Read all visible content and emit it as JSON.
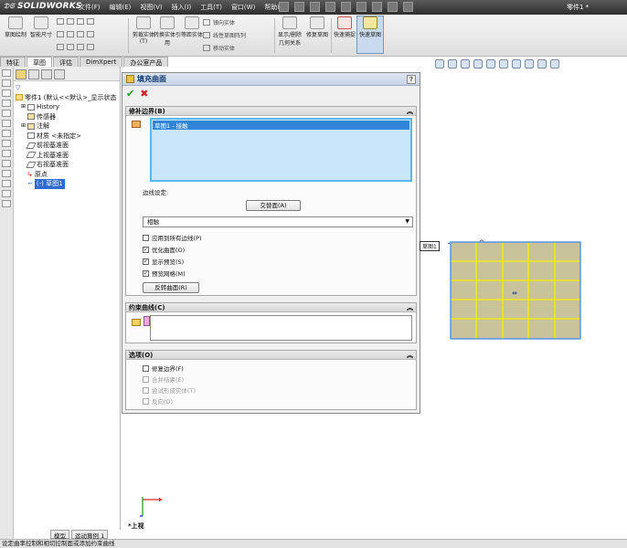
{
  "app": {
    "logo": "SOLIDWORKS",
    "doc_title": "零件1 *"
  },
  "menus": [
    "文件(F)",
    "编辑(E)",
    "视图(V)",
    "插入(I)",
    "工具(T)",
    "窗口(W)",
    "帮助(H)"
  ],
  "ribbon": {
    "buttons": [
      {
        "label": "草图绘制",
        "icon": "sketch-icon"
      },
      {
        "label": "智能尺寸",
        "icon": "smart-dimension-icon"
      },
      {
        "label": "剪裁实体(T)",
        "icon": "trim-icon"
      },
      {
        "label": "转换实体引用",
        "icon": "convert-entities-icon"
      },
      {
        "label": "等距实体",
        "icon": "offset-entities-icon"
      },
      {
        "label": "显示/删除几何关系",
        "icon": "relations-icon"
      },
      {
        "label": "修复草图",
        "icon": "repair-sketch-icon"
      },
      {
        "label": "快速捕捉",
        "icon": "quick-snaps-icon"
      },
      {
        "label": "快速草图",
        "icon": "rapid-sketch-icon"
      }
    ],
    "small_items": [
      "镜向实体",
      "线性草图阵列",
      "移动实体"
    ]
  },
  "tabs": [
    "特征",
    "草图",
    "评估",
    "DimXpert",
    "办公室产品"
  ],
  "active_tab": "草图",
  "tree": {
    "root": "零件1 (默认<<默认>_显示状态",
    "items": [
      "History",
      "传感器",
      "注解",
      "材质 <未指定>",
      "前视基准面",
      "上视基准面",
      "右视基准面",
      "原点",
      "(-) 草图1"
    ]
  },
  "fm_bottom_tabs": [
    "模型",
    "运动算例 1"
  ],
  "pm": {
    "title": "填充曲面",
    "help": "?",
    "patch_boundary": {
      "heading": "修补边界(B)",
      "list_item": "草图1 - 接触",
      "edge_settings_label": "边线设定:",
      "alternate_face_button": "交替面(A)",
      "edge_mode": "相触",
      "apply_all_edges": "应用到所有边线(P)",
      "optimize_surface": "优化曲面(O)",
      "show_preview": "显示预览(S)",
      "preview_mesh": "预览网格(M)",
      "reverse_surface_button": "反转曲面(R)"
    },
    "constraint_curves": {
      "heading": "约束曲线(C)"
    },
    "options": {
      "heading": "选项(O)",
      "fix_boundary": "修复边界(F)",
      "merge_result": "合并结果(E)",
      "try_solid": "尝试形成实体(T)",
      "reverse": "反向(D)"
    }
  },
  "graphics": {
    "sketch_label": "草图1",
    "view_name": "*上视"
  },
  "status_text": "设定曲率控制和相切控制面或添加约束曲线",
  "colors": {
    "accent": "#2f86d6",
    "mesh_fill": "#c9c39c",
    "mesh_line": "#f4f000"
  }
}
